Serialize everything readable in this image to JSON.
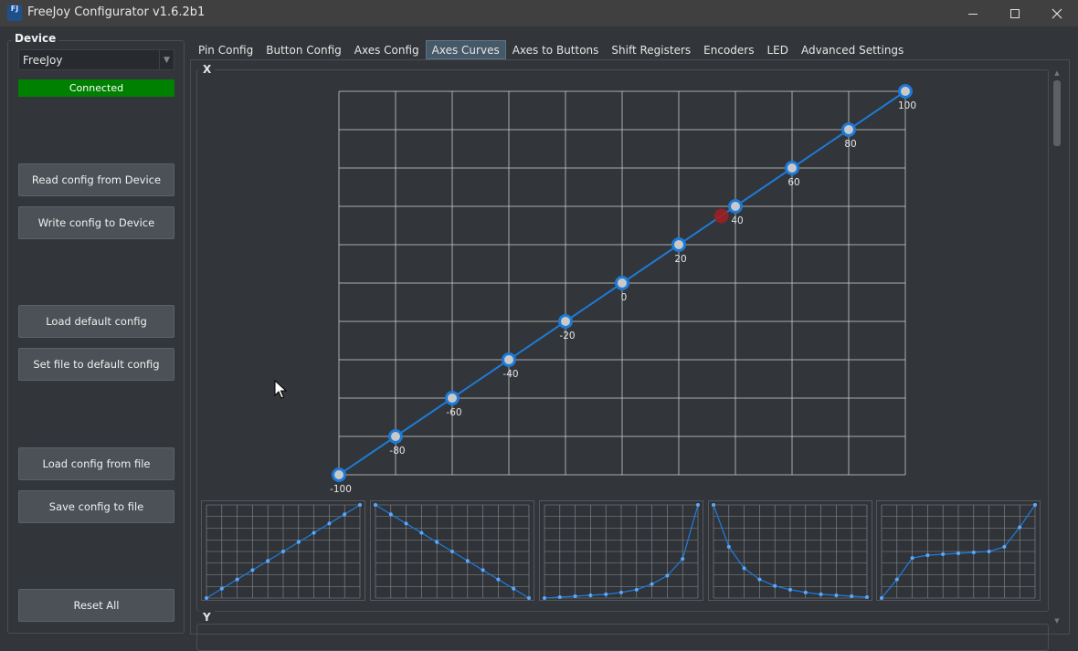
{
  "window": {
    "title": "FreeJoy Configurator v1.6.2b1",
    "icon_text": "FJ",
    "minimize_icon": "minimize-icon",
    "maximize_icon": "maximize-icon",
    "close_icon": "close-icon"
  },
  "sidebar": {
    "group_label": "Device",
    "device_select_value": "FreeJoy",
    "status": "Connected",
    "status_color": "#008000",
    "buttons": {
      "read": "Read config from Device",
      "write": "Write config to Device",
      "load_default": "Load default config",
      "set_default": "Set file to default config",
      "load_file": "Load config from file",
      "save_file": "Save config to file",
      "reset": "Reset All"
    }
  },
  "tabs": [
    "Pin Config",
    "Button Config",
    "Axes Config",
    "Axes Curves",
    "Axes to Buttons",
    "Shift Registers",
    "Encoders",
    "LED",
    "Advanced Settings"
  ],
  "active_tab": "Axes Curves",
  "axes": {
    "x_label": "X",
    "y_label": "Y"
  },
  "colors": {
    "curve": "#1e7ad6",
    "point_fill": "#c9c9c9",
    "current_marker": "#9b1f24",
    "grid": "#c8c8c8",
    "chart_bg": "#323539"
  },
  "chart_data": {
    "type": "line",
    "x": [
      -100,
      -80,
      -60,
      -40,
      -20,
      0,
      20,
      40,
      60,
      80,
      100
    ],
    "y": [
      -100,
      -80,
      -60,
      -40,
      -20,
      0,
      20,
      40,
      60,
      80,
      100
    ],
    "point_labels": [
      "-100",
      "-80",
      "-60",
      "-40",
      "-20",
      "0",
      "20",
      "40",
      "60",
      "80",
      "100"
    ],
    "xlim": [
      -100,
      100
    ],
    "ylim": [
      -100,
      100
    ],
    "grid": true,
    "current_value": {
      "x": 35,
      "y": 35
    }
  },
  "presets": [
    {
      "name": "linear",
      "values": [
        0,
        10,
        20,
        30,
        40,
        50,
        60,
        70,
        80,
        90,
        100
      ]
    },
    {
      "name": "inverted",
      "values": [
        100,
        90,
        80,
        70,
        60,
        50,
        40,
        30,
        20,
        10,
        0
      ]
    },
    {
      "name": "exponential",
      "values": [
        0,
        1,
        2,
        3,
        4,
        6,
        9,
        15,
        24,
        42,
        100
      ]
    },
    {
      "name": "inverted-exponential",
      "values": [
        100,
        55,
        32,
        20,
        13,
        9,
        6,
        4,
        3,
        2,
        1
      ]
    },
    {
      "name": "s-curve",
      "values": [
        0,
        20,
        43,
        46,
        47,
        48,
        49,
        50,
        55,
        76,
        100
      ]
    }
  ]
}
